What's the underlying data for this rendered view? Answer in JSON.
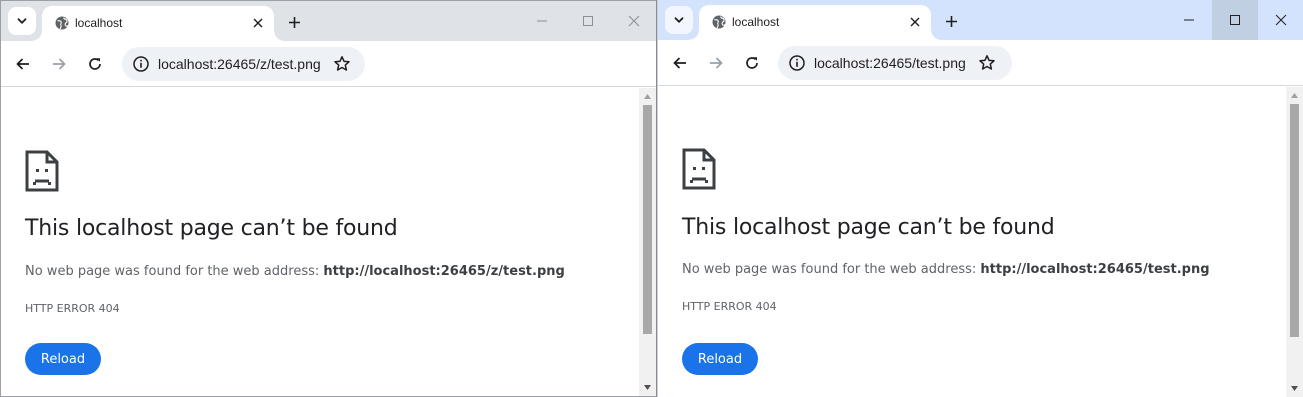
{
  "windows": [
    {
      "tab": {
        "title": "localhost",
        "favicon": "globe-icon"
      },
      "omnibox": {
        "url": "localhost:26465/z/test.png"
      },
      "error": {
        "title": "This localhost page can’t be found",
        "description_prefix": "No web page was found for the web address: ",
        "address": "http://localhost:26465/z/test.png",
        "code": "HTTP ERROR 404",
        "reload_label": "Reload"
      },
      "tabstrip_color": "#dfe3e8"
    },
    {
      "tab": {
        "title": "localhost",
        "favicon": "globe-icon"
      },
      "omnibox": {
        "url": "localhost:26465/test.png"
      },
      "error": {
        "title": "This localhost page can’t be found",
        "description_prefix": "No web page was found for the web address: ",
        "address": "http://localhost:26465/test.png",
        "code": "HTTP ERROR 404",
        "reload_label": "Reload"
      },
      "tabstrip_color": "#d3e3fd"
    }
  ],
  "colors": {
    "accent": "#1a73e8",
    "text_primary": "#202124",
    "text_secondary": "#5f6368"
  }
}
